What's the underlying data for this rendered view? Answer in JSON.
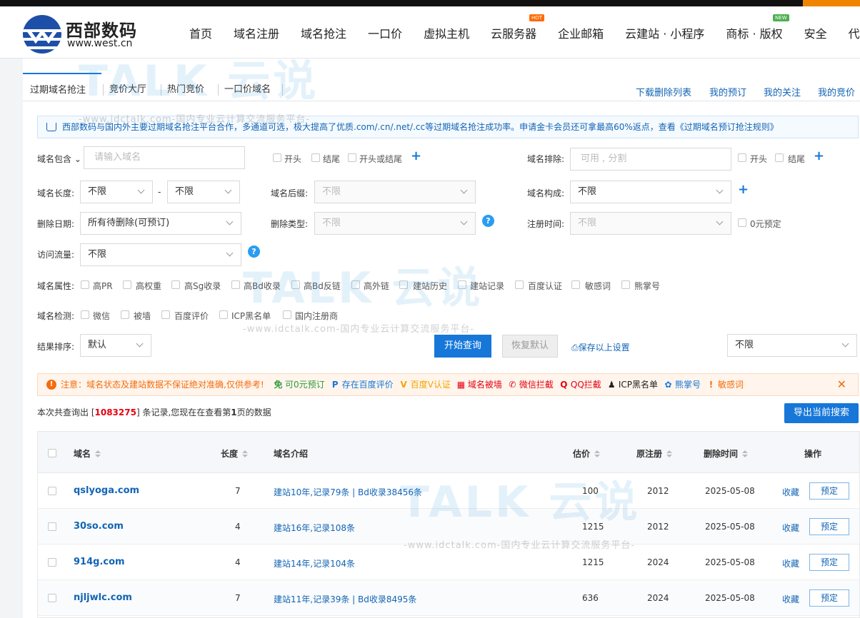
{
  "header": {
    "brand_name": "西部数码",
    "brand_url": "www.west.cn",
    "nav": [
      {
        "label": "首页"
      },
      {
        "label": "域名注册"
      },
      {
        "label": "域名抢注"
      },
      {
        "label": "一口价"
      },
      {
        "label": "虚拟主机"
      },
      {
        "label": "云服务器",
        "badge": "HOT"
      },
      {
        "label": "企业邮箱"
      },
      {
        "label": "云建站 · 小程序"
      },
      {
        "label": "商标 · 版权",
        "badge": "NEW"
      },
      {
        "label": "安全"
      },
      {
        "label": "代理合作"
      }
    ]
  },
  "subtabs": {
    "items": [
      "过期域名抢注",
      "竞价大厅",
      "热门竞价",
      "一口价域名"
    ],
    "right": [
      "下载删除列表",
      "我的预订",
      "我的关注",
      "我的竞价"
    ]
  },
  "notice": "西部数码与国内外主要过期域名抢注平台合作，多通道可选，极大提高了优质.com/.cn/.net/.cc等过期域名抢注成功率。申请金卡会员还可拿最高60%返点，查看《过期域名预订抢注规则》",
  "filters": {
    "contains_label": "域名包含",
    "contains_placeholder": "请输入域名",
    "start": "开头",
    "end": "结尾",
    "start_or_end": "开头或结尾",
    "exclude_label": "域名排除:",
    "exclude_placeholder": "可用 , 分割",
    "length_label": "域名长度:",
    "length_min": "不限",
    "length_max": "不限",
    "dash": "-",
    "suffix_label": "域名后缀:",
    "suffix_value": "不限",
    "compose_label": "域名构成:",
    "compose_value": "不限",
    "delete_date_label": "删除日期:",
    "delete_date_value": "所有待删除(可预订)",
    "delete_type_label": "删除类型:",
    "delete_type_value": "不限",
    "reg_time_label": "注册时间:",
    "reg_time_value": "不限",
    "zero_label": "0元预定",
    "traffic_label": "访问流量:",
    "traffic_value": "不限",
    "attr_label": "域名属性:",
    "attrs": [
      "高PR",
      "高权重",
      "高Sg收录",
      "高Bd收录",
      "高Bd反链",
      "高外链",
      "建站历史",
      "建站记录",
      "百度认证",
      "敏感词",
      "熊掌号"
    ],
    "check_label": "域名检测:",
    "checks": [
      "微信",
      "被墙",
      "百度评价",
      "ICP黑名单",
      "国内注册商"
    ],
    "sort_label": "结果排序:",
    "sort_value": "默认",
    "search_btn": "开始查询",
    "reset_btn": "恢复默认",
    "save_link": "保存以上设置",
    "right_select": "不限"
  },
  "warning": {
    "text": "注意：域名状态及建站数据不保证绝对准确,仅供参考!",
    "legend": [
      {
        "glyph": "免",
        "text": "可0元预订",
        "color": "#2e9b3a"
      },
      {
        "glyph": "P",
        "text": "存在百度评价",
        "color": "#1677d9"
      },
      {
        "glyph": "V",
        "text": "百度V认证",
        "color": "#f5a300"
      },
      {
        "glyph": "▦",
        "text": "域名被墙",
        "color": "#e60012"
      },
      {
        "glyph": "✆",
        "text": "微信拦截",
        "color": "#e60012"
      },
      {
        "glyph": "Q",
        "text": "QQ拦截",
        "color": "#e60012"
      },
      {
        "glyph": "♟",
        "text": "ICP黑名单",
        "color": "#222"
      },
      {
        "glyph": "✿",
        "text": "熊掌号",
        "color": "#1677d9"
      },
      {
        "glyph": "!",
        "text": "敏感词",
        "color": "#f56c0d"
      }
    ]
  },
  "summary": {
    "prefix": "本次共查询出 [",
    "count": "1083275",
    "mid": "] 条记录,您现在在查看第",
    "page": "1",
    "suffix": "页的数据"
  },
  "export_btn": "导出当前搜索",
  "table": {
    "headers": {
      "domain": "域名",
      "length": "长度",
      "intro": "域名介绍",
      "price": "估价",
      "orig_reg": "原注册",
      "del_time": "删除时间",
      "action": "操作"
    },
    "rows": [
      {
        "domain": "qslyoga.com",
        "length": "7",
        "intro": "建站10年,记录79条 | Bd收录38456条",
        "price": "100",
        "orig_reg": "2012",
        "del_time": "2025-05-08",
        "fav": "收藏",
        "reserve": "预定"
      },
      {
        "domain": "30so.com",
        "length": "4",
        "intro": "建站16年,记录108条",
        "price": "1215",
        "orig_reg": "2012",
        "del_time": "2025-05-08",
        "fav": "收藏",
        "reserve": "预定"
      },
      {
        "domain": "914g.com",
        "length": "4",
        "intro": "建站14年,记录104条",
        "price": "1215",
        "orig_reg": "2024",
        "del_time": "2025-05-08",
        "fav": "收藏",
        "reserve": "预定"
      },
      {
        "domain": "njljwlc.com",
        "length": "7",
        "intro": "建站11年,记录39条 | Bd收录8495条",
        "price": "636",
        "orig_reg": "2024",
        "del_time": "2025-05-08",
        "fav": "收藏",
        "reserve": "预定"
      }
    ]
  },
  "watermark": {
    "brand": "TALK 云说",
    "url": "-www.idctalk.com-国内专业云计算交流服务平台-"
  }
}
